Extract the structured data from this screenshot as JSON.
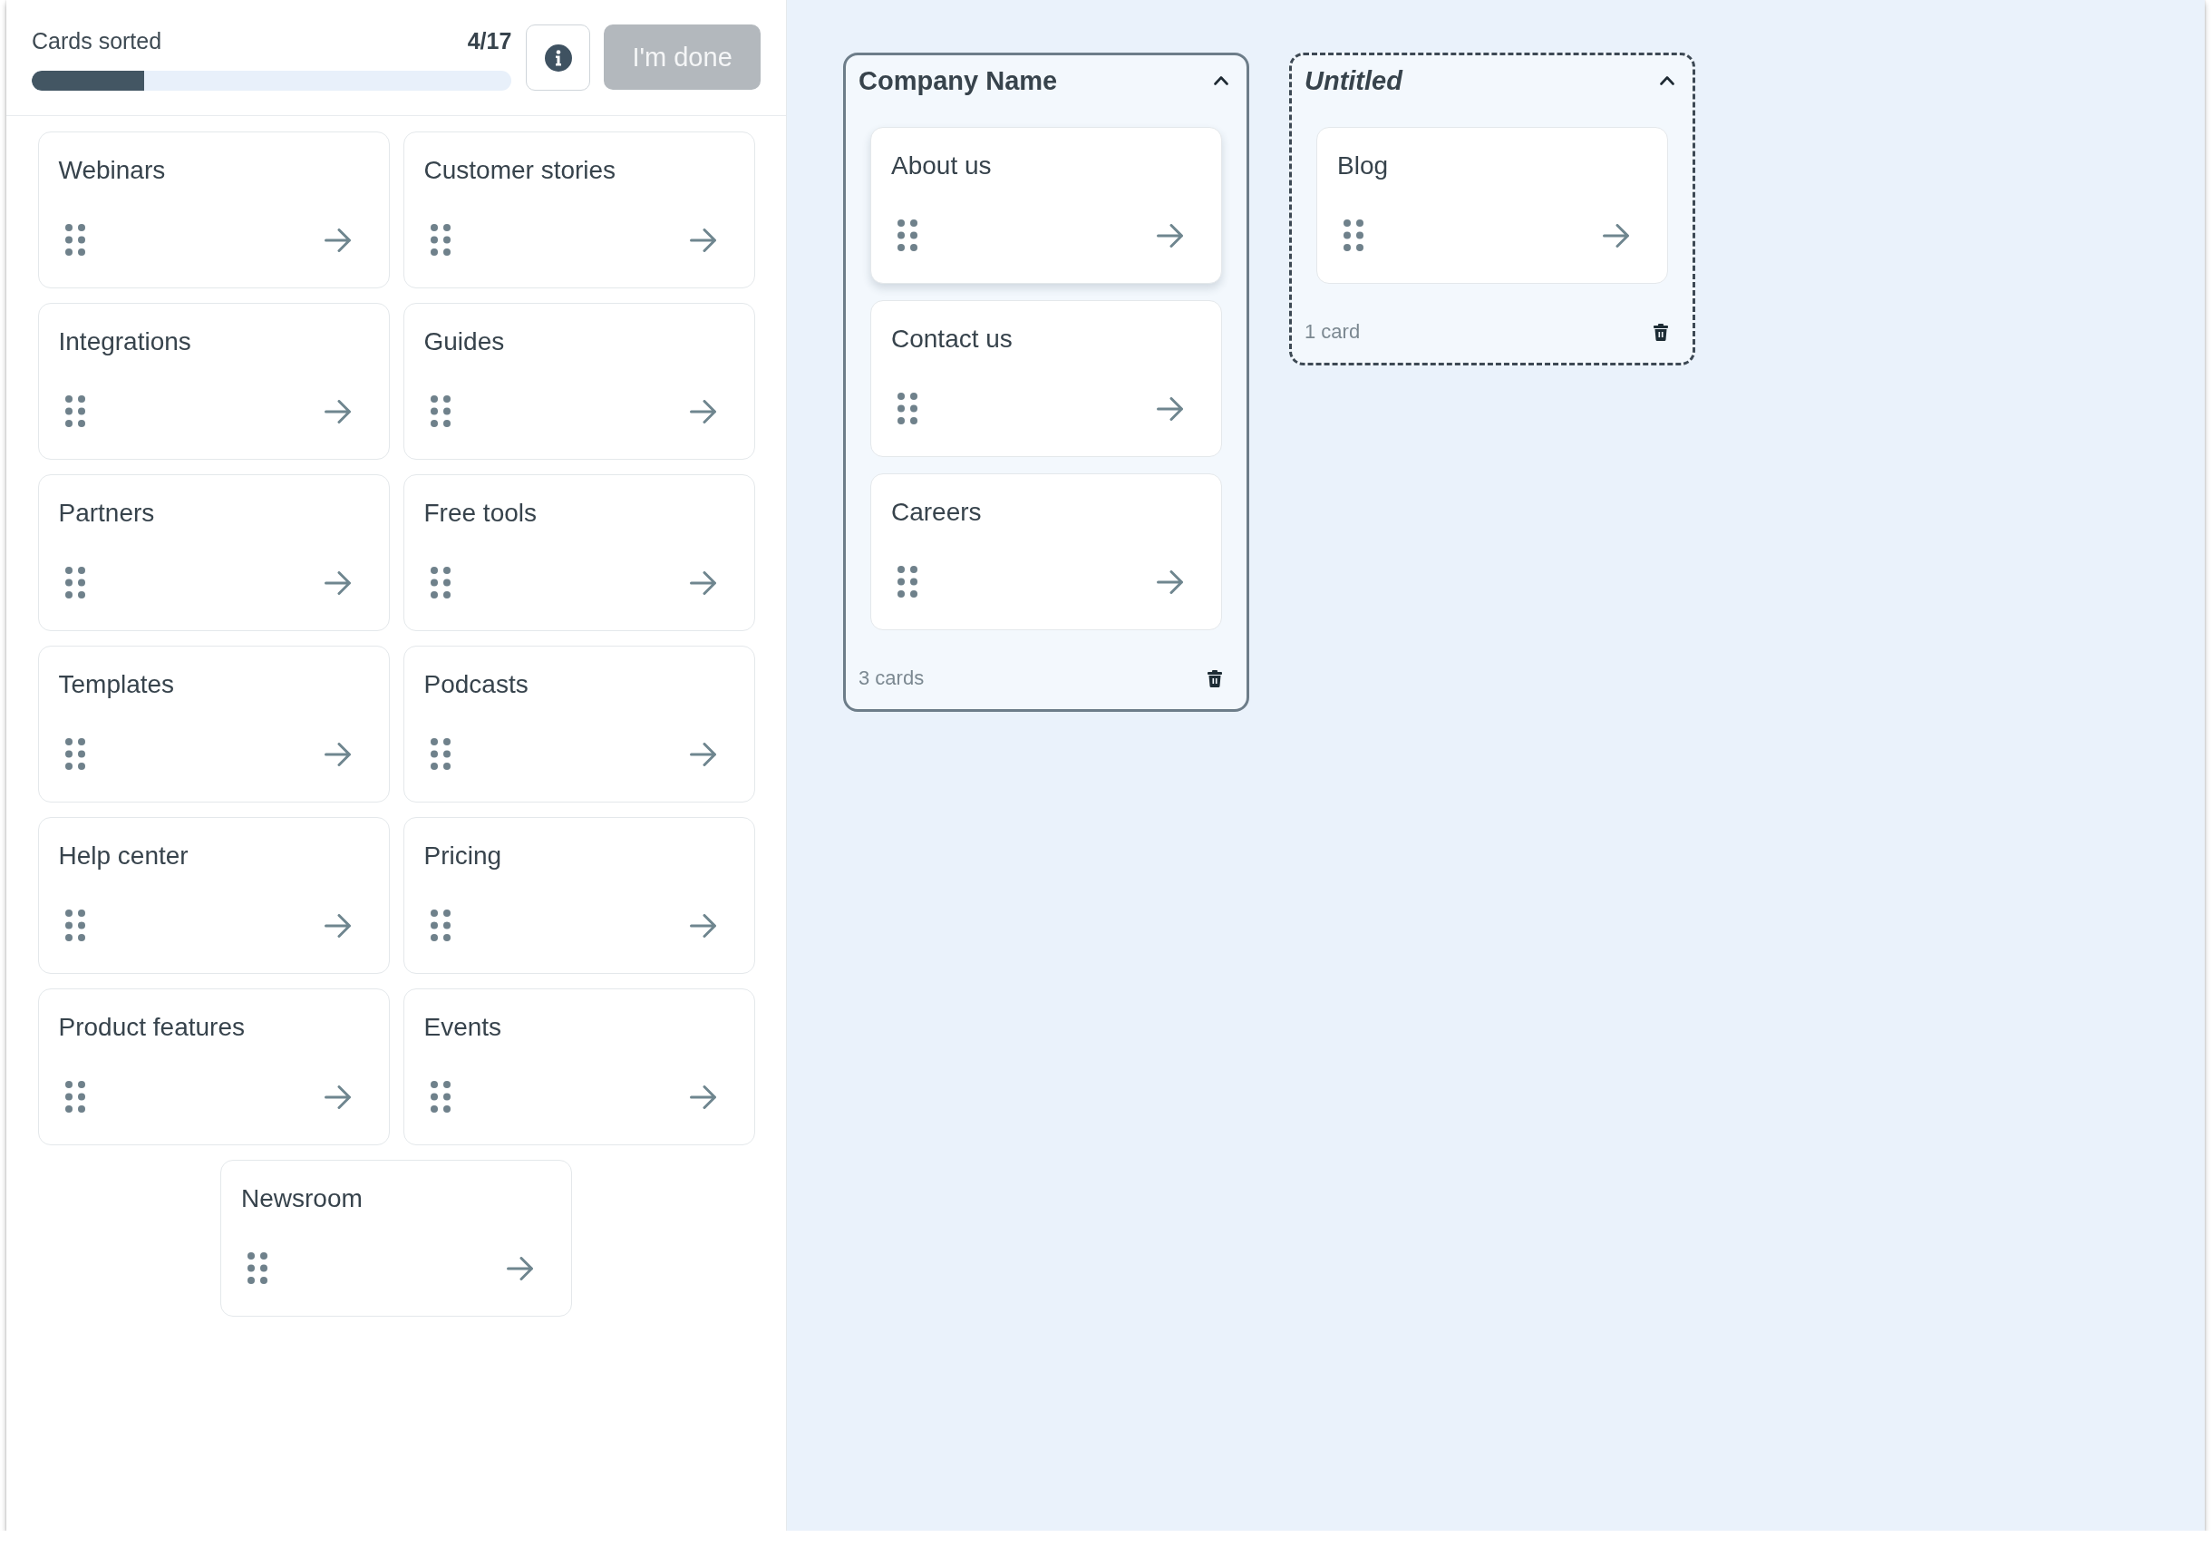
{
  "progress": {
    "label": "Cards sorted",
    "count": "4/17",
    "level": 0.235
  },
  "done_button": {
    "label": "I'm done",
    "disabled": true
  },
  "cards": [
    "Webinars",
    "Customer stories",
    "Integrations",
    "Guides",
    "Partners",
    "Free tools",
    "Templates",
    "Podcasts",
    "Help center",
    "Pricing",
    "Product features",
    "Events",
    "Newsroom"
  ],
  "groups": [
    {
      "title": "Company Name",
      "kind": "named",
      "expanded": true,
      "cards": [
        {
          "label": "About us",
          "raised": true
        },
        {
          "label": "Contact us",
          "raised": false
        },
        {
          "label": "Careers",
          "raised": false
        }
      ],
      "count": "3 cards"
    },
    {
      "title": "Untitled",
      "kind": "unnamed",
      "expanded": true,
      "cards": [
        {
          "label": "Blog",
          "raised": false
        }
      ],
      "count": "1 card"
    }
  ]
}
